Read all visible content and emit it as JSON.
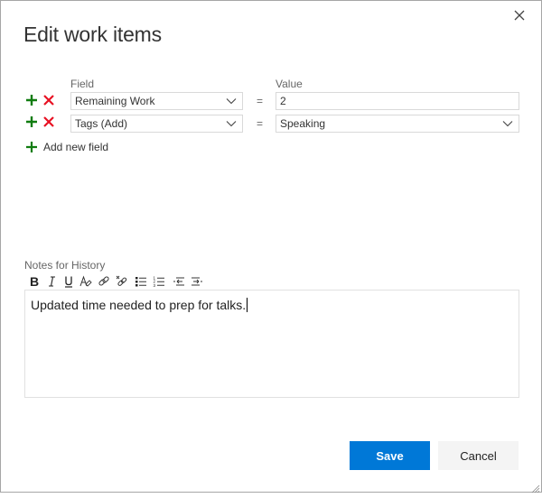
{
  "dialog": {
    "title": "Edit work items",
    "close_icon": "close-icon"
  },
  "fields": {
    "field_column_label": "Field",
    "value_column_label": "Value",
    "rows": [
      {
        "field": "Remaining Work",
        "operator": "=",
        "value": "2",
        "value_type": "text",
        "add_icon": "plus-icon",
        "remove_icon": "x-icon"
      },
      {
        "field": "Tags (Add)",
        "operator": "=",
        "value": "Speaking",
        "value_type": "dropdown",
        "add_icon": "plus-icon",
        "remove_icon": "x-icon"
      }
    ],
    "add_new_field_label": "Add new field"
  },
  "notes": {
    "label": "Notes for History",
    "toolbar": [
      {
        "name": "bold",
        "glyph": "B"
      },
      {
        "name": "italic",
        "glyph": "I"
      },
      {
        "name": "underline",
        "glyph": "U"
      },
      {
        "name": "highlight",
        "glyph": "A"
      },
      {
        "name": "link",
        "glyph": "link"
      },
      {
        "name": "unlink",
        "glyph": "unlink"
      },
      {
        "name": "bulleted-list",
        "glyph": "bullets"
      },
      {
        "name": "numbered-list",
        "glyph": "numbers"
      },
      {
        "name": "decrease-indent",
        "glyph": "outdent"
      },
      {
        "name": "increase-indent",
        "glyph": "indent"
      }
    ],
    "content": "Updated time needed to prep for talks."
  },
  "buttons": {
    "save_label": "Save",
    "cancel_label": "Cancel"
  },
  "colors": {
    "primary": "#0078d7",
    "add_green": "#107c10",
    "remove_red": "#e81123",
    "secondary_button_bg": "#f4f4f4"
  }
}
